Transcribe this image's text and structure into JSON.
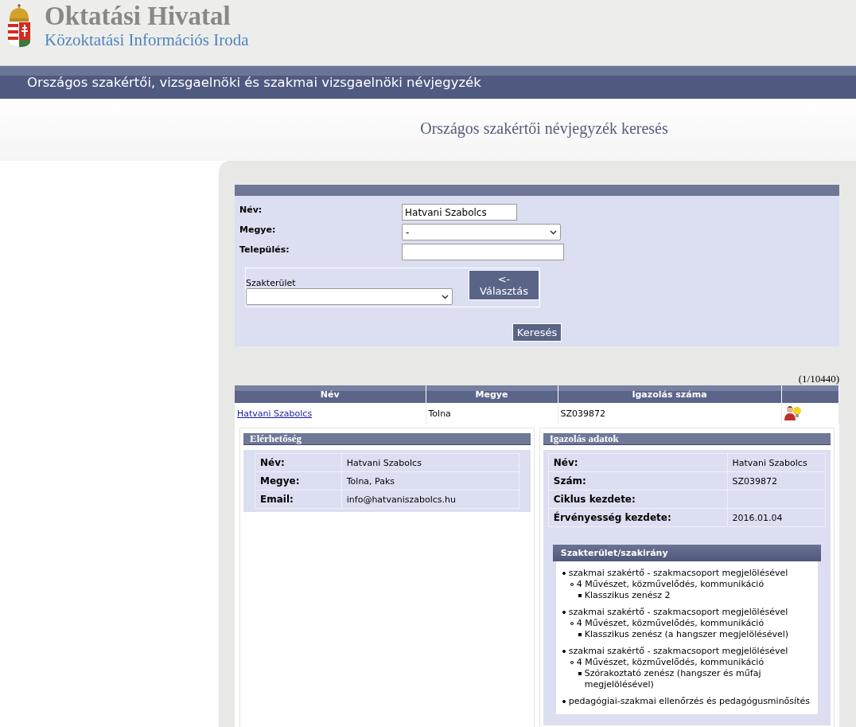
{
  "header": {
    "title": "Oktatási Hivatal",
    "subtitle": "Közoktatási Információs Iroda"
  },
  "banner": "Országos szakértői, vizsgaelnöki és szakmai vizsgaelnöki névjegyzék",
  "page_title": "Országos szakértői névjegyzék keresés",
  "search_form": {
    "fields": [
      {
        "kind": "text",
        "label": "Név:",
        "value": "Hatvani Szabolcs"
      },
      {
        "kind": "select",
        "label": "Megye:",
        "value": "-"
      },
      {
        "kind": "text",
        "label": "Település:"
      }
    ],
    "specialty": {
      "label": "Szakterület",
      "button": "<- Választás"
    },
    "submit": "Keresés"
  },
  "result_count": "(1/10440)",
  "table": {
    "columns": [
      "Név",
      "Megye",
      "Igazolás száma"
    ],
    "rows": [
      {
        "name": "Hatvani Szabolcs",
        "county": "Tolna",
        "number": "SZ039872"
      }
    ]
  },
  "contact": {
    "title": "Elérhetőség",
    "rows": [
      {
        "label": "Név:",
        "value": "Hatvani Szabolcs"
      },
      {
        "label": "Megye:",
        "value": "Tolna, Paks"
      },
      {
        "label": "Email:",
        "value": "info@hatvaniszabolcs.hu"
      }
    ]
  },
  "certificate": {
    "title": "Igazolás adatok",
    "rows": [
      {
        "label": "Név:",
        "value": "Hatvani Szabolcs"
      },
      {
        "label": "Szám:",
        "value": "SZ039872"
      },
      {
        "label": "Ciklus kezdete:"
      },
      {
        "label": "Érvényesség kezdete:",
        "value": "2016.01.04"
      }
    ],
    "specialties": {
      "title": "Szakterület/szakirány",
      "items": [
        {
          "text": "szakmai szakértő - szakmacsoport megjelölésével",
          "children": [
            {
              "text": "4 Művészet, közművelődés, kommunikáció",
              "children": [
                {
                  "text": "Klasszikus zenész 2"
                }
              ]
            }
          ]
        },
        {
          "text": "szakmai szakértő - szakmacsoport megjelölésével",
          "children": [
            {
              "text": "4 Művészet, közművelődés, kommunikáció",
              "children": [
                {
                  "text": "Klasszikus zenész (a hangszer megjelölésével)"
                }
              ]
            }
          ]
        },
        {
          "text": "szakmai szakértő - szakmacsoport megjelölésével",
          "children": [
            {
              "text": "4 Művészet, közművelődés, kommunikáció",
              "children": [
                {
                  "text": "Szórakoztató zenész (hangszer és műfaj megjelölésével)"
                }
              ]
            }
          ]
        },
        {
          "text": "pedagógiai-szakmai ellenőrzés és pedagógusminősítés"
        }
      ]
    }
  }
}
